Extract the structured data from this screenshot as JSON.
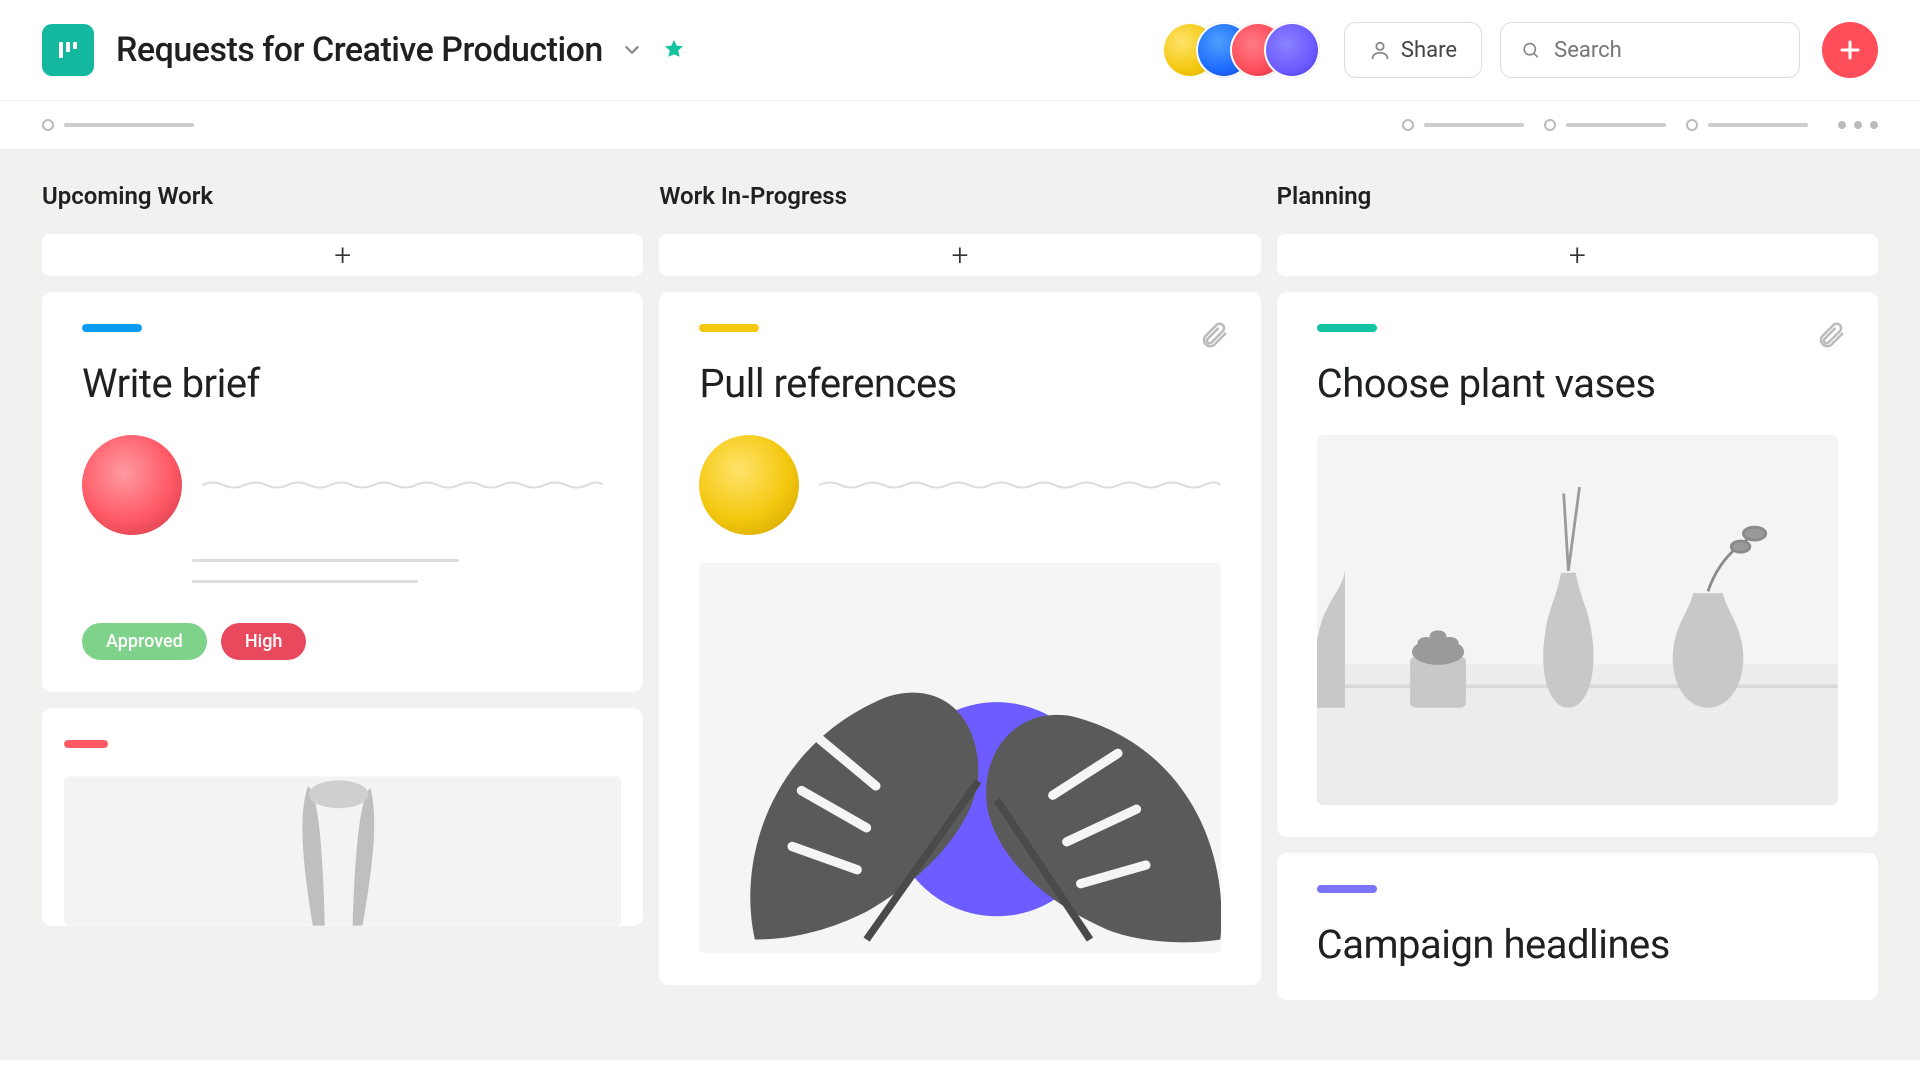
{
  "header": {
    "page_title": "Requests for Creative Production",
    "share_label": "Share",
    "search_placeholder": "Search",
    "collaborators": [
      {
        "color": "#f4c80f"
      },
      {
        "color": "#1f77ff"
      },
      {
        "color": "#ff4d5a"
      },
      {
        "color": "#6d5cff"
      }
    ]
  },
  "board": {
    "columns": [
      {
        "title": "Upcoming Work",
        "cards": [
          {
            "stripe_color": "#0c9bf2",
            "title": "Write brief",
            "assignee_color": "#ff5a66",
            "tags": [
              {
                "label": "Approved",
                "bg": "#7fd28a"
              },
              {
                "label": "High",
                "bg": "#e8495d"
              }
            ]
          },
          {
            "stripe_color": "#ff5a66",
            "title": ""
          }
        ]
      },
      {
        "title": "Work In-Progress",
        "cards": [
          {
            "stripe_color": "#f4c80f",
            "title": "Pull  references",
            "assignee_color": "#f4c80f",
            "has_attachment": true
          }
        ]
      },
      {
        "title": "Planning",
        "cards": [
          {
            "stripe_color": "#14c3a2",
            "title": "Choose plant vases",
            "has_attachment": true
          },
          {
            "stripe_color": "#7a73ff",
            "title": "Campaign headlines"
          }
        ]
      }
    ]
  }
}
